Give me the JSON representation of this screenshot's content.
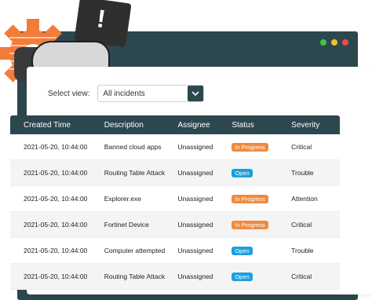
{
  "window": {
    "dots": [
      "#3ec63e",
      "#f2c12e",
      "#ef4a4a"
    ]
  },
  "illustration": {
    "sign_text": "!"
  },
  "filter": {
    "label": "Select view:",
    "value": "All incidents"
  },
  "table": {
    "headers": [
      "Created Time",
      "Description",
      "Assignee",
      "Status",
      "Severity"
    ],
    "rows": [
      {
        "created": "2021-05-20, 10:44:00",
        "description": "Banned cloud apps",
        "assignee": "Unassigned",
        "status": "In Progress",
        "severity": "Critical"
      },
      {
        "created": "2021-05-20, 10:44:00",
        "description": "Routing Table Attack",
        "assignee": "Unassigned",
        "status": "Open",
        "severity": "Trouble"
      },
      {
        "created": "2021-05-20, 10:44:00",
        "description": "Explorer.exe",
        "assignee": "Unassigned",
        "status": "In Progress",
        "severity": "Attention"
      },
      {
        "created": "2021-05-20, 10:44:00",
        "description": "Fortinet Device",
        "assignee": "Unassigned",
        "status": "In Progress",
        "severity": "Critical"
      },
      {
        "created": "2021-05-20, 10:44:00",
        "description": "Computer attempted",
        "assignee": "Unassigned",
        "status": "Open",
        "severity": "Trouble"
      },
      {
        "created": "2021-05-20, 10:44:00",
        "description": "Routing Table Attack",
        "assignee": "Unassigned",
        "status": "Open",
        "severity": "Critical"
      }
    ]
  },
  "colors": {
    "frame": "#2d474f",
    "in_progress": "#f08a3c",
    "open": "#1aa0e0"
  }
}
